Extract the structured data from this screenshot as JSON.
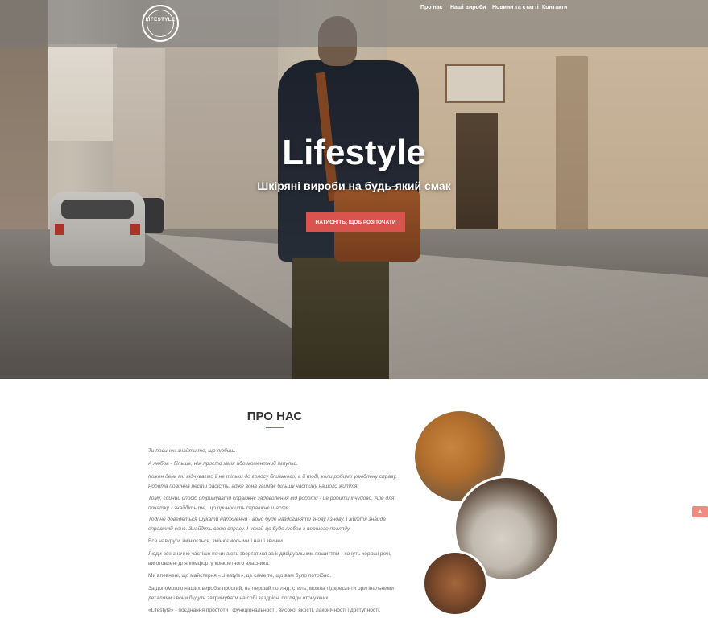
{
  "logo": {
    "text": "LIFESTYLE"
  },
  "nav": {
    "items": [
      {
        "label": "Про нас"
      },
      {
        "label": "Наші вироби"
      },
      {
        "label": "Новини та статті"
      },
      {
        "label": "Контакти"
      }
    ]
  },
  "hero": {
    "title": "Lifestyle",
    "subtitle": "Шкіряні вироби на будь-який смак",
    "cta": "НАТИСНІТЬ, ЩОБ РОЗПОЧАТИ"
  },
  "about": {
    "title": "ПРО НАС",
    "paragraphs": [
      "Ти повинен знайти те, що любиш.",
      "А любов - більше, ніж просто хімія або моментний імпульс.",
      "Кожен день ми відчуваємо її не тільки до голосу близького, а й тоді, коли робимо улюблену справу. Робота повинна нести радість, адже вона займає більшу частину нашого життя.",
      "Тому, єдиний спосіб отримувати справжнє задоволення від роботи - це робити її чудово. Але для початку - знайдіть те, що приносить справжнє щастя.",
      "Тоді не доведеться шукати натхнення - воно буде наздоганяти знову і знову, і життя знайде справжній сенс. Знайдіть свою справу. І нехай це буде любов з першого погляду.",
      "Все навкруги змінюється, змінюємось ми і наші звички.",
      "Люди все значно частіше починають звертатися за індивідуальним пошиттям - хочуть хороші речі, виготовлені для комфорту конкретного власника.",
      "Ми впевнені, що майстерня «Lifestyle», це саме те, що вам було потрібно.",
      "За допомогою наших виробів простий, на перший погляд, стиль, можна підкреслити оригінальними деталями і вони будуть затримувати на собі заздрісні погляди оточуючих.",
      "«Lifestyle» - поєднання простоти і функціональності, високої якості, лаконічності і доступності."
    ]
  },
  "scroll_top": {
    "icon": "chevron-up-icon",
    "glyph": "▲"
  }
}
